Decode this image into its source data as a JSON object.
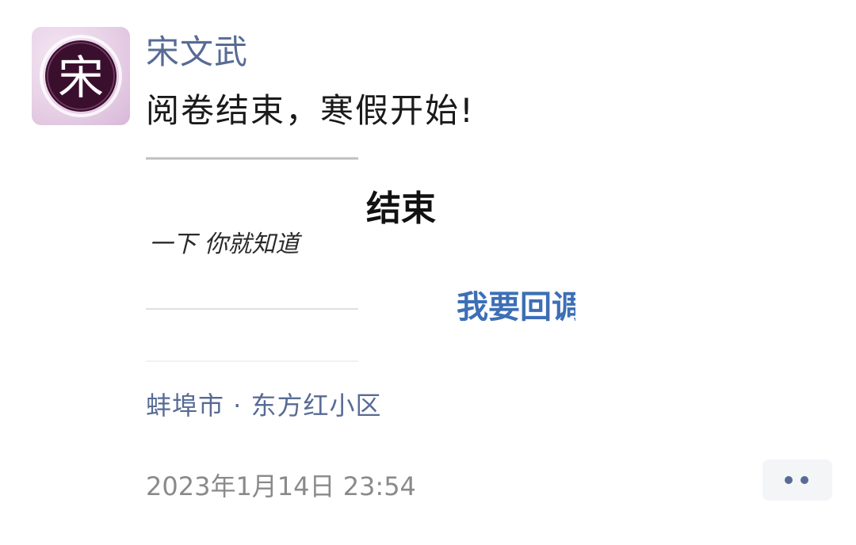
{
  "post": {
    "avatar": {
      "char": "宋",
      "icon": "avatar-icon"
    },
    "author": "宋文武",
    "text": "阅卷结束，寒假开始!",
    "image": {
      "title_text": "结束",
      "handwriting": "一下 你就知道",
      "link_text": "我要回调"
    },
    "location": "蚌埠市 · 东方红小区",
    "timestamp": "2023年1月14日 23:54"
  },
  "actions": {
    "more_icon": "more-dots-icon"
  },
  "colors": {
    "author_link": "#576b95",
    "image_link": "#3d6fb6",
    "timestamp": "#8a8a8a"
  }
}
